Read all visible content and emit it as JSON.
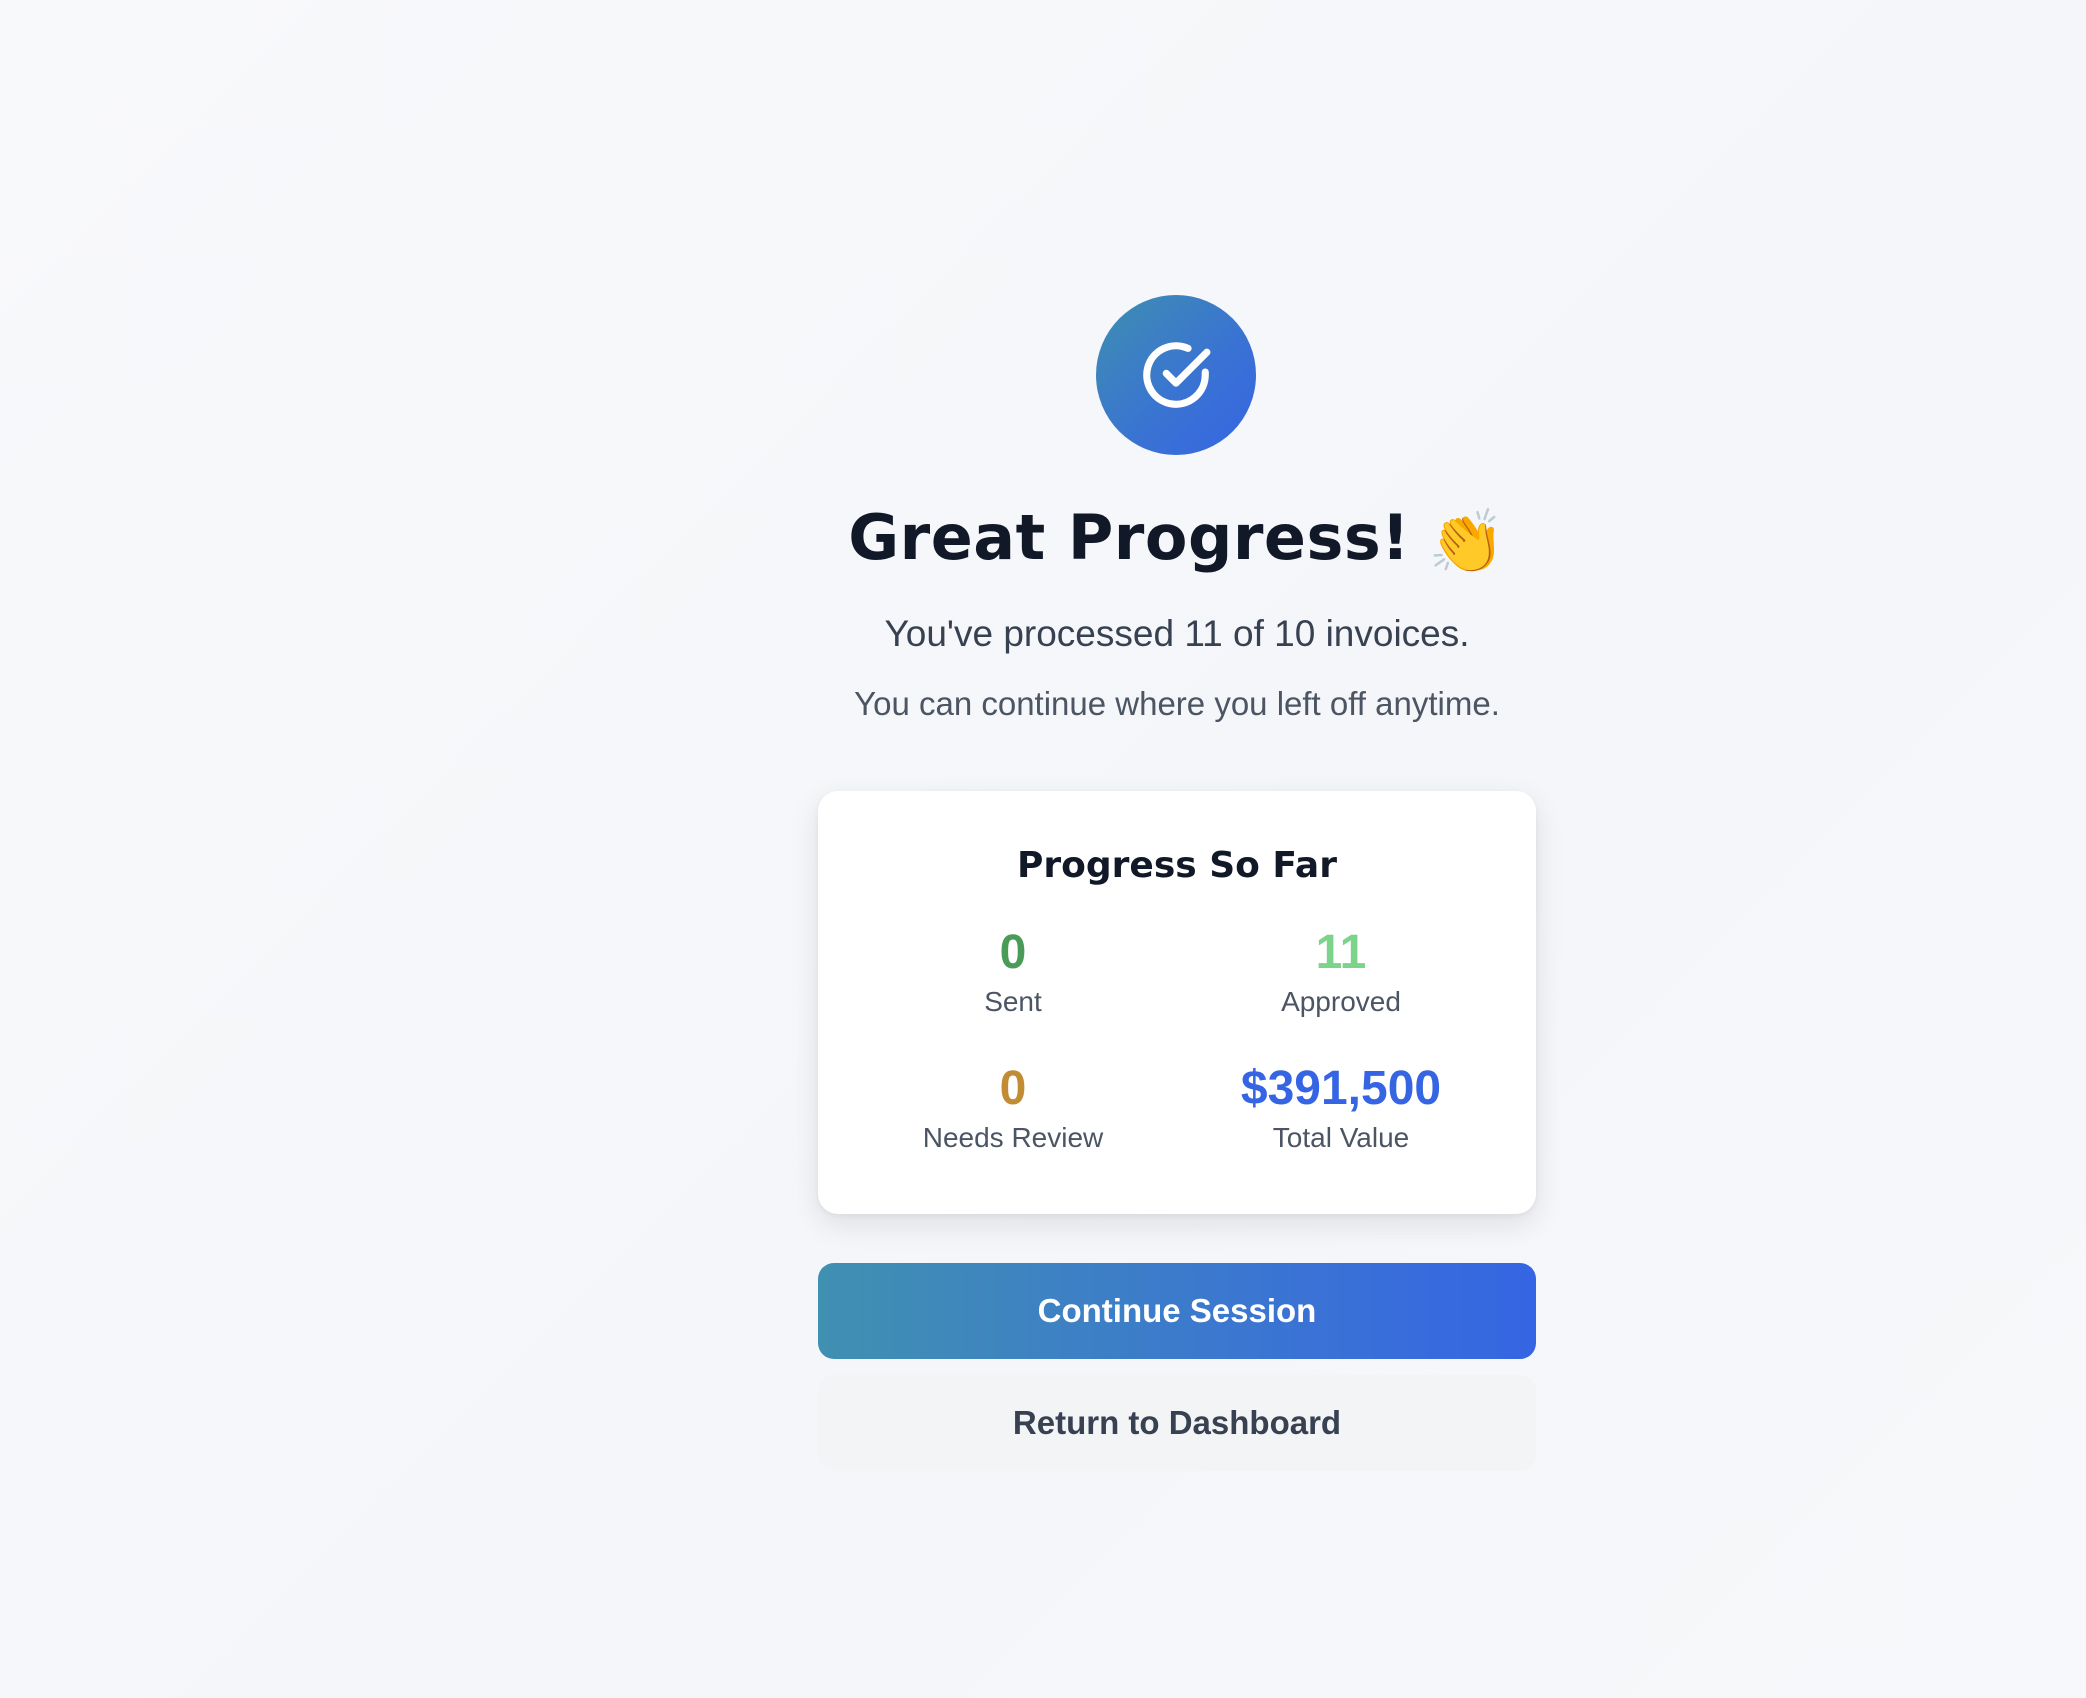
{
  "header": {
    "icon": "check-circle-icon",
    "title": "Great Progress!",
    "title_emoji": "👏",
    "subtitle": "You've processed 11 of 10 invoices.",
    "subtitle2": "You can continue where you left off anytime."
  },
  "progress_card": {
    "title": "Progress So Far",
    "stats": [
      {
        "value": "0",
        "label": "Sent",
        "color": "#4a9b57"
      },
      {
        "value": "11",
        "label": "Approved",
        "color": "#7cd48a"
      },
      {
        "value": "0",
        "label": "Needs Review",
        "color": "#c18c33"
      },
      {
        "value": "$391,500",
        "label": "Total Value",
        "color": "#3565e3"
      }
    ]
  },
  "actions": {
    "continue_label": "Continue Session",
    "return_label": "Return to Dashboard"
  },
  "colors": {
    "accent_start": "#4090b1",
    "accent_end": "#3565e3"
  }
}
